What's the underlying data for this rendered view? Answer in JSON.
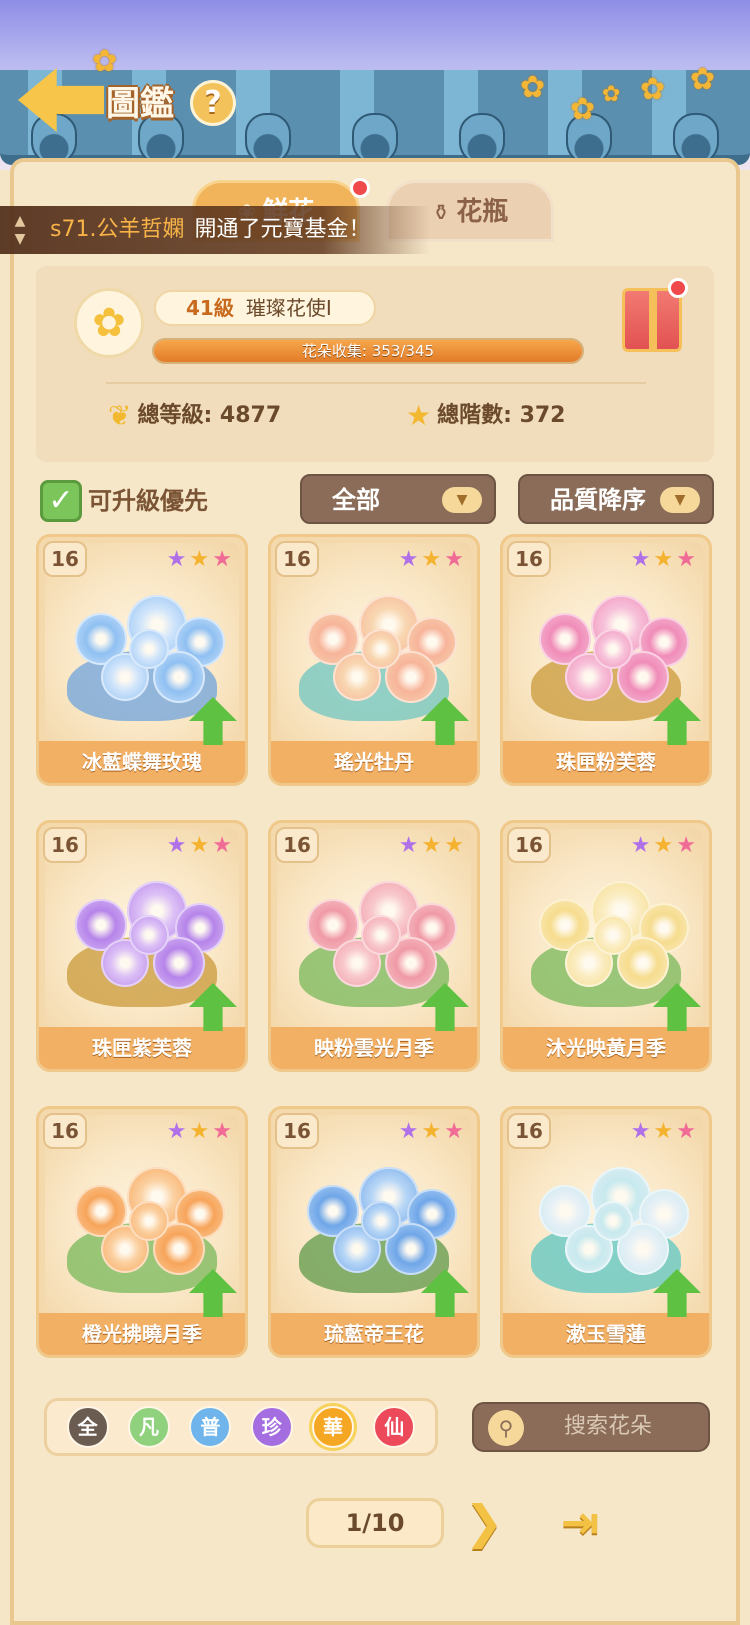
{
  "header": {
    "title": "圖鑑",
    "help_icon": "?"
  },
  "tabs": [
    {
      "label": "鮮花",
      "icon": "flower-icon",
      "active": true
    },
    {
      "label": "花瓶",
      "icon": "vase-icon",
      "active": false
    }
  ],
  "ticker": {
    "name": "s71.公羊哲嫻",
    "message": "開通了元寶基金！"
  },
  "stats": {
    "level": "41級",
    "rank": "璀璨花使I",
    "collection_label": "花朵收集: 353/345",
    "collection_progress": 1.0,
    "total_level": "總等級: 4877",
    "total_tier": "總階數: 372"
  },
  "filters": {
    "upgradable_first_label": "可升級優先",
    "upgradable_first_checked": true,
    "category": "全部",
    "sort": "品質降序"
  },
  "flowers": [
    {
      "name": "冰藍蝶舞玫瑰",
      "level": "16",
      "stars": [
        "purple",
        "orange",
        "pink"
      ],
      "palette": [
        "#8fc0f2",
        "#cfe4fb",
        "#6fa3dc"
      ],
      "upgrade": true
    },
    {
      "name": "瑤光牡丹",
      "level": "16",
      "stars": [
        "purple",
        "orange",
        "pink"
      ],
      "palette": [
        "#f7b49a",
        "#f8d6b0",
        "#6fc5c0"
      ],
      "upgrade": true
    },
    {
      "name": "珠匣粉芙蓉",
      "level": "16",
      "stars": [
        "purple",
        "orange",
        "pink"
      ],
      "palette": [
        "#f08cb8",
        "#f7c2da",
        "#c99a3a"
      ],
      "upgrade": true
    },
    {
      "name": "珠匣紫芙蓉",
      "level": "16",
      "stars": [
        "purple",
        "orange",
        "pink"
      ],
      "palette": [
        "#b684ea",
        "#dcc0f6",
        "#c99a3a"
      ],
      "upgrade": true
    },
    {
      "name": "映粉雲光月季",
      "level": "16",
      "stars": [
        "purple",
        "orange",
        "orange"
      ],
      "palette": [
        "#f09aa6",
        "#f8c8cc",
        "#78b85a"
      ],
      "upgrade": true
    },
    {
      "name": "沐光映黃月季",
      "level": "16",
      "stars": [
        "purple",
        "orange",
        "pink"
      ],
      "palette": [
        "#f6dc8e",
        "#fbedc2",
        "#78b85a"
      ],
      "upgrade": true
    },
    {
      "name": "橙光拂曉月季",
      "level": "16",
      "stars": [
        "purple",
        "orange",
        "pink"
      ],
      "palette": [
        "#f7a45a",
        "#fbd0a0",
        "#78b85a"
      ],
      "upgrade": true
    },
    {
      "name": "琉藍帝王花",
      "level": "16",
      "stars": [
        "purple",
        "orange",
        "pink"
      ],
      "palette": [
        "#6fa6e8",
        "#b7d6f6",
        "#5e9a4a"
      ],
      "upgrade": true
    },
    {
      "name": "漱玉雪蓮",
      "level": "16",
      "stars": [
        "purple",
        "orange",
        "pink"
      ],
      "palette": [
        "#e6f0f6",
        "#c7e9ee",
        "#5cc6c2"
      ],
      "upgrade": true
    }
  ],
  "rarity_filters": [
    {
      "label": "全",
      "color": "#6b5c52"
    },
    {
      "label": "凡",
      "color": "#8fd17c"
    },
    {
      "label": "普",
      "color": "#6fb4ea"
    },
    {
      "label": "珍",
      "color": "#a56ee0"
    },
    {
      "label": "華",
      "color": "#f5a623"
    },
    {
      "label": "仙",
      "color": "#ec4a5a"
    }
  ],
  "search": {
    "placeholder": "搜索花朵"
  },
  "pagination": {
    "current": "1/10"
  },
  "colors": {
    "accent": "#f2b065",
    "panel": "#f7e7c9",
    "dropdown": "#8a6c58",
    "upgrade_arrow": "#5ec142"
  }
}
